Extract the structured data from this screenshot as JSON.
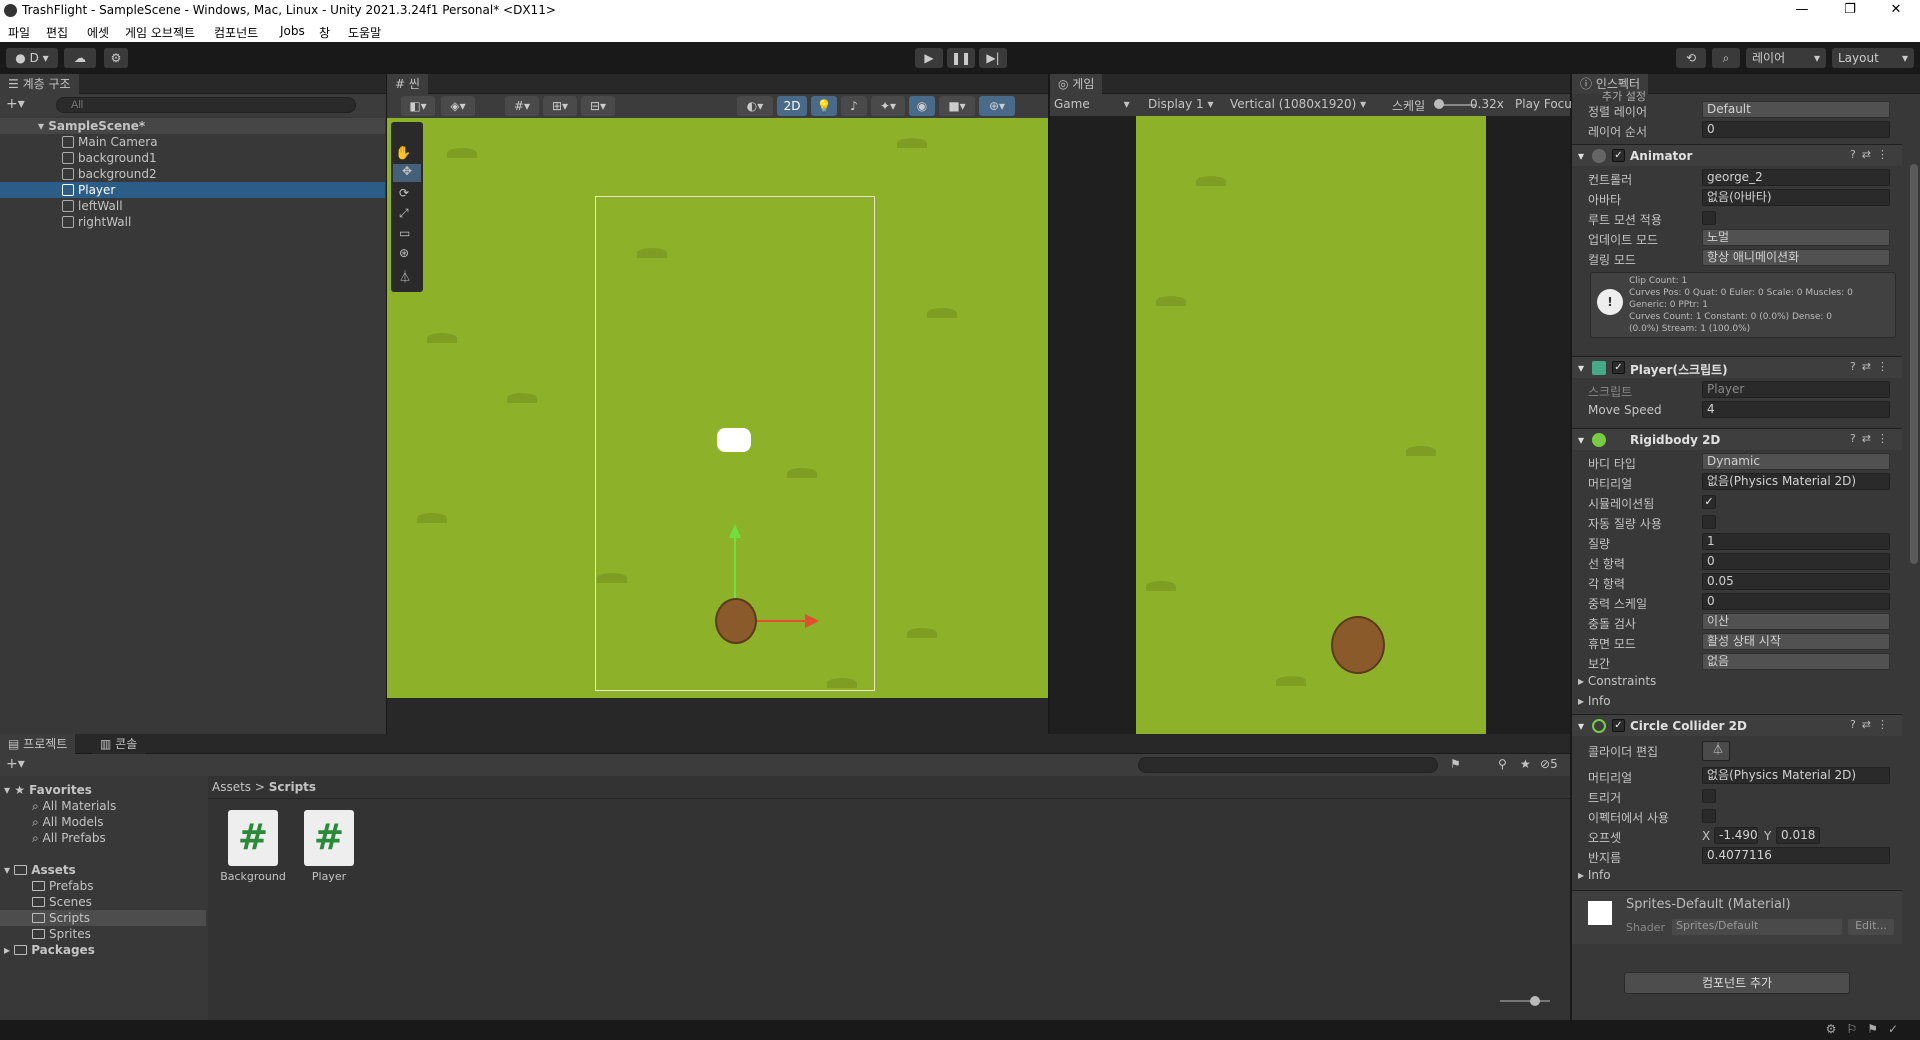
{
  "window": {
    "title": "TrashFlight - SampleScene - Windows, Mac, Linux - Unity 2021.3.24f1 Personal* <DX11>",
    "minimize": "—",
    "maximize": "❐",
    "close": "✕"
  },
  "menu": [
    "파일",
    "편집",
    "에셋",
    "게임 오브젝트",
    "컴포넌트",
    "Jobs",
    "창",
    "도움말"
  ],
  "toolbar": {
    "account": "D",
    "layers": "레이어",
    "layout": "Layout"
  },
  "hierarchy": {
    "tab": "계층 구조",
    "search_placeholder": "All",
    "scene": "SampleScene*",
    "items": [
      "Main Camera",
      "background1",
      "background2",
      "Player",
      "leftWall",
      "rightWall"
    ],
    "selected": "Player"
  },
  "scene": {
    "tab": "씬",
    "mode_2d": "2D"
  },
  "game": {
    "tab": "게임",
    "view": "Game",
    "display": "Display 1",
    "resolution": "Vertical (1080x1920)",
    "scale_label": "스케일",
    "scale_value": "0.32x",
    "play_focus": "Play Focu"
  },
  "project": {
    "tab": "프로젝트",
    "console_tab": "콘솔",
    "favorites": "Favorites",
    "fav_items": [
      "All Materials",
      "All Models",
      "All Prefabs"
    ],
    "assets": "Assets",
    "asset_items": [
      "Prefabs",
      "Scenes",
      "Scripts",
      "Sprites"
    ],
    "selected_folder": "Scripts",
    "packages": "Packages",
    "breadcrumb_root": "Assets",
    "breadcrumb_sep": ">",
    "breadcrumb_current": "Scripts",
    "files": [
      "Background",
      "Player"
    ],
    "hidden_count": "5"
  },
  "inspector": {
    "tab": "인스펙터",
    "sorting_cut": "추가 설정",
    "sorting_layer_label": "정렬 레이어",
    "sorting_layer_value": "Default",
    "order_label": "레이어 순서",
    "order_value": "0",
    "animator": {
      "title": "Animator",
      "controller_label": "컨트롤러",
      "controller_value": "george_2",
      "avatar_label": "아바타",
      "avatar_value": "없음(아바타)",
      "root_motion_label": "루트 모션 적용",
      "update_mode_label": "업데이트 모드",
      "update_mode_value": "노멀",
      "culling_label": "컬링 모드",
      "culling_value": "항상 애니메이션화",
      "info": [
        "Clip Count: 1",
        "Curves Pos: 0 Quat: 0 Euler: 0 Scale: 0 Muscles: 0",
        "Generic: 0 PPtr: 1",
        "Curves Count: 1 Constant: 0 (0.0%) Dense: 0",
        "(0.0%) Stream: 1 (100.0%)"
      ]
    },
    "player_script": {
      "title": "Player(스크립트)",
      "script_label": "스크립트",
      "script_value": "Player",
      "move_speed_label": "Move Speed",
      "move_speed_value": "4"
    },
    "rigidbody": {
      "title": "Rigidbody 2D",
      "body_type_label": "바디 타입",
      "body_type_value": "Dynamic",
      "material_label": "머티리얼",
      "material_value": "없음(Physics Material 2D)",
      "simulated_label": "시뮬레이션됨",
      "auto_mass_label": "자동 질량 사용",
      "mass_label": "질량",
      "mass_value": "1",
      "linear_drag_label": "선 항력",
      "linear_drag_value": "0",
      "angular_drag_label": "각 항력",
      "angular_drag_value": "0.05",
      "gravity_label": "중력 스케일",
      "gravity_value": "0",
      "collision_label": "충돌 검사",
      "collision_value": "이산",
      "sleep_label": "휴면 모드",
      "sleep_value": "활성 상태 시작",
      "interp_label": "보간",
      "interp_value": "없음",
      "constraints": "Constraints",
      "info": "Info"
    },
    "collider": {
      "title": "Circle Collider 2D",
      "edit_label": "콜라이더 편집",
      "material_label": "머티리얼",
      "material_value": "없음(Physics Material 2D)",
      "trigger_label": "트리거",
      "effector_label": "이펙터에서 사용",
      "offset_label": "오프셋",
      "offset_x_label": "X",
      "offset_x": "-1.490",
      "offset_y_label": "Y",
      "offset_y": "0.018",
      "radius_label": "반지름",
      "radius_value": "0.4077116",
      "info": "Info"
    },
    "material": {
      "name": "Sprites-Default (Material)",
      "shader_label": "Shader",
      "shader_value": "Sprites/Default",
      "edit": "Edit..."
    },
    "add_component": "컴포넌트 추가"
  },
  "colors": {
    "accent": "#2c5d87",
    "grass": "#8eb12a",
    "panel": "#383838"
  }
}
